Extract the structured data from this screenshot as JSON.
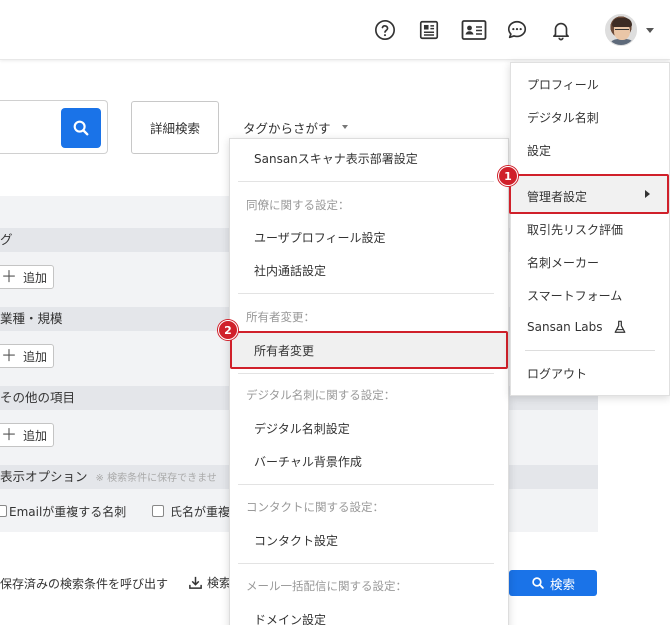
{
  "header": {
    "icons": [
      "help-icon",
      "news-icon",
      "card-icon",
      "chat-icon",
      "bell-icon"
    ]
  },
  "search": {
    "detail_label": "詳細検索",
    "tag_search_label": "タグからさがす"
  },
  "left_panel": {
    "sections": [
      {
        "title": "グ",
        "add_label": "追加"
      },
      {
        "title": "業種・規模",
        "add_label": "追加"
      },
      {
        "title": "その他の項目",
        "add_label": "追加"
      }
    ],
    "display_options": {
      "title": "表示オプション",
      "note": "※ 検索条件に保存できませ",
      "checks": [
        "Emailが重複する名刺",
        "氏名が重複"
      ]
    },
    "saved_search_label": "保存済みの検索条件を呼び出す",
    "save_label": "検索",
    "search_button_label": "検索"
  },
  "dropdown": {
    "top_item": "Sansanスキャナ表示部署設定",
    "groups": [
      {
        "label": "同僚に関する設定：",
        "items": [
          "ユーザプロフィール設定",
          "社内通話設定"
        ]
      },
      {
        "label": "所有者変更：",
        "items": [
          "所有者変更"
        ]
      },
      {
        "label": "デジタル名刺に関する設定：",
        "items": [
          "デジタル名刺設定",
          "バーチャル背景作成"
        ]
      },
      {
        "label": "コンタクトに関する設定：",
        "items": [
          "コンタクト設定"
        ]
      },
      {
        "label": "メール一括配信に関する設定：",
        "items": [
          "ドメイン設定"
        ]
      }
    ]
  },
  "user_menu": {
    "items": [
      "プロフィール",
      "デジタル名刺",
      "設定",
      "管理者設定",
      "取引先リスク評価",
      "名刺メーカー",
      "スマートフォーム",
      "Sansan Labs"
    ],
    "logout": "ログアウト"
  },
  "badges": [
    "1",
    "2"
  ],
  "colors": {
    "accent": "#1a73e8",
    "highlight": "#d0202a"
  }
}
